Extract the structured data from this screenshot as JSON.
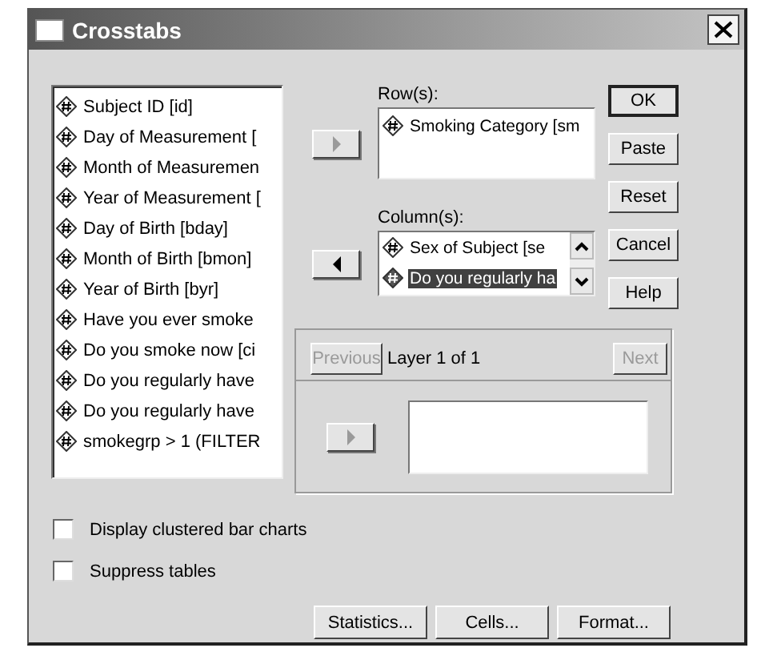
{
  "window": {
    "title": "Crosstabs"
  },
  "variables": [
    {
      "label": "Subject ID [id]",
      "selected": false
    },
    {
      "label": "Day of Measurement [",
      "selected": false
    },
    {
      "label": "Month of Measuremen",
      "selected": false
    },
    {
      "label": "Year of Measurement [",
      "selected": false
    },
    {
      "label": "Day of Birth [bday]",
      "selected": false
    },
    {
      "label": "Month of Birth [bmon]",
      "selected": false
    },
    {
      "label": "Year of Birth [byr]",
      "selected": false
    },
    {
      "label": "Have you ever smoke",
      "selected": false
    },
    {
      "label": "Do you smoke now [ci",
      "selected": false
    },
    {
      "label": "Do you regularly have",
      "selected": false
    },
    {
      "label": "Do you regularly have",
      "selected": false
    },
    {
      "label": "smokegrp > 1 (FILTER",
      "selected": false
    }
  ],
  "move_buttons": [
    {
      "kind": "right",
      "disabled": true
    },
    {
      "kind": "left",
      "disabled": false
    }
  ],
  "rows": {
    "label": "Row(s):",
    "items": [
      {
        "label": "Smoking Category [sm",
        "selected": false
      }
    ]
  },
  "columns": {
    "label": "Column(s):",
    "items": [
      {
        "label": "Sex of Subject [se",
        "selected": false
      },
      {
        "label": "Do you regularly ha",
        "selected": true
      }
    ]
  },
  "buttons": [
    {
      "label": "OK",
      "default": true
    },
    {
      "label": "Paste",
      "default": false
    },
    {
      "label": "Reset",
      "default": false
    },
    {
      "label": "Cancel",
      "default": false
    },
    {
      "label": "Help",
      "default": false
    }
  ],
  "layer": {
    "previous": {
      "label": "Previous",
      "disabled": true
    },
    "text": "Layer 1 of 1",
    "next": {
      "label": "Next",
      "disabled": true
    },
    "move_button": {
      "kind": "right",
      "disabled": true
    }
  },
  "options": [
    {
      "label": "Display clustered bar charts",
      "checked": false
    },
    {
      "label": "Suppress tables",
      "checked": false
    }
  ],
  "bottom_buttons": [
    "Statistics...",
    "Cells...",
    "Format..."
  ]
}
